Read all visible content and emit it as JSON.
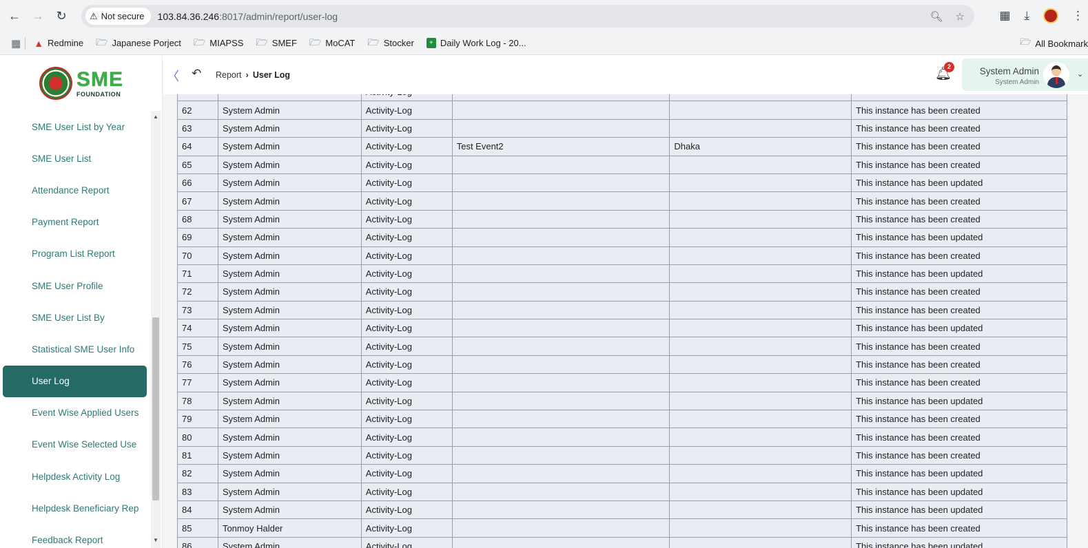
{
  "browser": {
    "security_label": "Not secure",
    "url_host": "103.84.36.246",
    "url_rest": ":8017/admin/report/user-log",
    "bookmarks": [
      {
        "label": "Redmine",
        "icon": "redmine-icon"
      },
      {
        "label": "Japanese Porject",
        "icon": "folder-icon"
      },
      {
        "label": "MIAPSS",
        "icon": "folder-icon"
      },
      {
        "label": "SMEF",
        "icon": "folder-icon"
      },
      {
        "label": "MoCAT",
        "icon": "folder-icon"
      },
      {
        "label": "Stocker",
        "icon": "folder-icon"
      },
      {
        "label": "Daily Work Log - 20...",
        "icon": "sheets-icon"
      }
    ],
    "all_bookmarks": "All Bookmark"
  },
  "brand": {
    "name": "SME",
    "tagline": "FOUNDATION"
  },
  "sidebar": {
    "items": [
      {
        "label": "SME User List by Year",
        "active": false
      },
      {
        "label": "SME User List",
        "active": false
      },
      {
        "label": "Attendance Report",
        "active": false
      },
      {
        "label": "Payment Report",
        "active": false
      },
      {
        "label": "Program List Report",
        "active": false
      },
      {
        "label": "SME User Profile",
        "active": false
      },
      {
        "label": "SME User List By",
        "active": false
      },
      {
        "label": "Statistical SME User Info",
        "active": false
      },
      {
        "label": "User Log",
        "active": true
      },
      {
        "label": "Event Wise Applied Users",
        "active": false
      },
      {
        "label": "Event Wise Selected Use",
        "active": false
      },
      {
        "label": "Helpdesk Activity Log",
        "active": false
      },
      {
        "label": "Helpdesk Beneficiary Rep",
        "active": false
      },
      {
        "label": "Feedback Report",
        "active": false
      }
    ]
  },
  "header": {
    "breadcrumb_parent": "Report",
    "breadcrumb_current": "User Log",
    "notification_count": "2",
    "user_name": "System Admin",
    "user_role": "System Admin"
  },
  "table": {
    "rows": [
      {
        "no": "",
        "user": "",
        "module": "Activity-Log",
        "event": "",
        "location": "",
        "message": ""
      },
      {
        "no": "62",
        "user": "System Admin",
        "module": "Activity-Log",
        "event": "",
        "location": "",
        "message": "This instance has been created"
      },
      {
        "no": "63",
        "user": "System Admin",
        "module": "Activity-Log",
        "event": "",
        "location": "",
        "message": "This instance has been created"
      },
      {
        "no": "64",
        "user": "System Admin",
        "module": "Activity-Log",
        "event": "Test Event2",
        "location": "Dhaka",
        "message": "This instance has been created"
      },
      {
        "no": "65",
        "user": "System Admin",
        "module": "Activity-Log",
        "event": "",
        "location": "",
        "message": "This instance has been created"
      },
      {
        "no": "66",
        "user": "System Admin",
        "module": "Activity-Log",
        "event": "",
        "location": "",
        "message": "This instance has been updated"
      },
      {
        "no": "67",
        "user": "System Admin",
        "module": "Activity-Log",
        "event": "",
        "location": "",
        "message": "This instance has been created"
      },
      {
        "no": "68",
        "user": "System Admin",
        "module": "Activity-Log",
        "event": "",
        "location": "",
        "message": "This instance has been created"
      },
      {
        "no": "69",
        "user": "System Admin",
        "module": "Activity-Log",
        "event": "",
        "location": "",
        "message": "This instance has been updated"
      },
      {
        "no": "70",
        "user": "System Admin",
        "module": "Activity-Log",
        "event": "",
        "location": "",
        "message": "This instance has been created"
      },
      {
        "no": "71",
        "user": "System Admin",
        "module": "Activity-Log",
        "event": "",
        "location": "",
        "message": "This instance has been updated"
      },
      {
        "no": "72",
        "user": "System Admin",
        "module": "Activity-Log",
        "event": "",
        "location": "",
        "message": "This instance has been created"
      },
      {
        "no": "73",
        "user": "System Admin",
        "module": "Activity-Log",
        "event": "",
        "location": "",
        "message": "This instance has been created"
      },
      {
        "no": "74",
        "user": "System Admin",
        "module": "Activity-Log",
        "event": "",
        "location": "",
        "message": "This instance has been updated"
      },
      {
        "no": "75",
        "user": "System Admin",
        "module": "Activity-Log",
        "event": "",
        "location": "",
        "message": "This instance has been created"
      },
      {
        "no": "76",
        "user": "System Admin",
        "module": "Activity-Log",
        "event": "",
        "location": "",
        "message": "This instance has been created"
      },
      {
        "no": "77",
        "user": "System Admin",
        "module": "Activity-Log",
        "event": "",
        "location": "",
        "message": "This instance has been created"
      },
      {
        "no": "78",
        "user": "System Admin",
        "module": "Activity-Log",
        "event": "",
        "location": "",
        "message": "This instance has been updated"
      },
      {
        "no": "79",
        "user": "System Admin",
        "module": "Activity-Log",
        "event": "",
        "location": "",
        "message": "This instance has been created"
      },
      {
        "no": "80",
        "user": "System Admin",
        "module": "Activity-Log",
        "event": "",
        "location": "",
        "message": "This instance has been created"
      },
      {
        "no": "81",
        "user": "System Admin",
        "module": "Activity-Log",
        "event": "",
        "location": "",
        "message": "This instance has been created"
      },
      {
        "no": "82",
        "user": "System Admin",
        "module": "Activity-Log",
        "event": "",
        "location": "",
        "message": "This instance has been updated"
      },
      {
        "no": "83",
        "user": "System Admin",
        "module": "Activity-Log",
        "event": "",
        "location": "",
        "message": "This instance has been updated"
      },
      {
        "no": "84",
        "user": "System Admin",
        "module": "Activity-Log",
        "event": "",
        "location": "",
        "message": "This instance has been updated"
      },
      {
        "no": "85",
        "user": "Tonmoy Halder",
        "module": "Activity-Log",
        "event": "",
        "location": "",
        "message": "This instance has been created"
      },
      {
        "no": "86",
        "user": "System Admin",
        "module": "Activity-Log",
        "event": "",
        "location": "",
        "message": "This instance has been updated"
      }
    ]
  },
  "colors": {
    "accent": "#256a66",
    "menu_text": "#2f7a76",
    "table_bg": "#e9ecf2",
    "badge": "#d32f2f"
  }
}
